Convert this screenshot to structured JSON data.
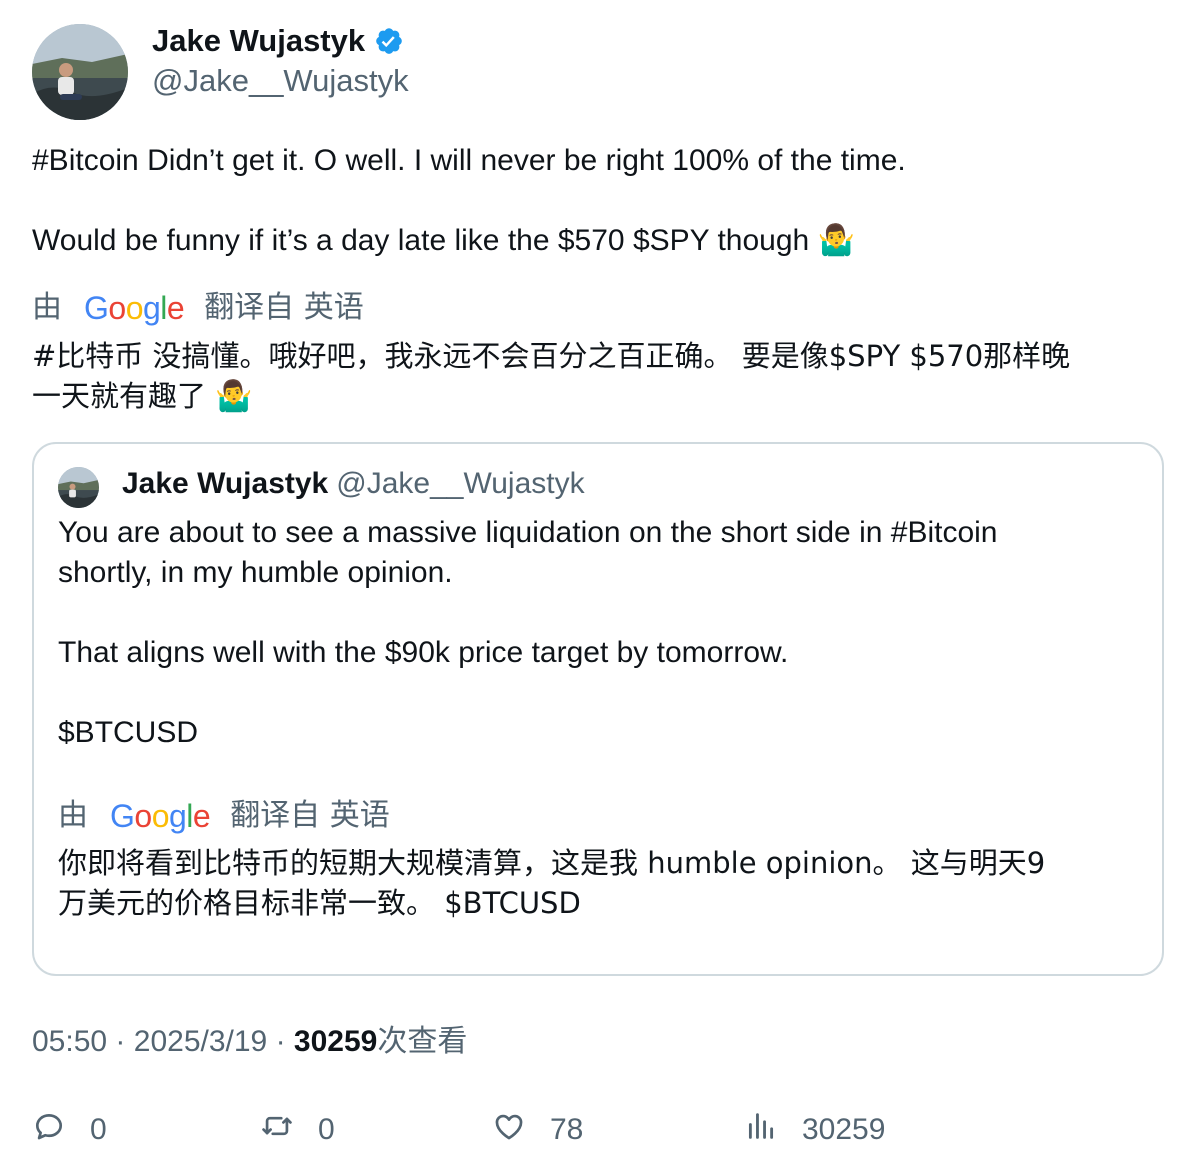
{
  "author": {
    "name": "Jake Wujastyk",
    "handle": "@Jake__Wujastyk"
  },
  "tweet": {
    "line1": "#Bitcoin Didn’t get it. O well. I will never be right 100% of the time.",
    "line2": "Would be funny if it’s a day late like the $570 $SPY though",
    "emoji": "🤷‍♂️"
  },
  "translation": {
    "by_label": "由",
    "google": [
      "G",
      "o",
      "o",
      "g",
      "l",
      "e"
    ],
    "from_label": "翻译自 英语",
    "line1": "#比特币 没搞懂。哦好吧，我永远不会百分之百正确。 要是像$SPY $570那样晚",
    "line2": "一天就有趣了"
  },
  "quote": {
    "name": "Jake Wujastyk",
    "handle": "@Jake__Wujastyk",
    "line1": "You are about to see a massive liquidation on the short side in #Bitcoin",
    "line2": "shortly, in my humble opinion.",
    "line3": "That aligns well with the $90k price target by tomorrow.",
    "line4": "$BTCUSD",
    "translation": {
      "by_label": "由",
      "from_label": "翻译自 英语",
      "line1": "你即将看到比特币的短期大规模清算，这是我 humble opinion。 这与明天9",
      "line2": "万美元的价格目标非常一致。 $BTCUSD"
    }
  },
  "meta": {
    "time": "05:50",
    "sep": "·",
    "date": "2025/3/19",
    "views_count": "30259",
    "views_label": "次查看"
  },
  "actions": {
    "replies": "0",
    "retweets": "0",
    "likes": "78",
    "views": "30259"
  },
  "colors": {
    "text": "#0f1419",
    "secondary": "#536471",
    "verified": "#1d9bf0",
    "border": "#cfd9de"
  }
}
